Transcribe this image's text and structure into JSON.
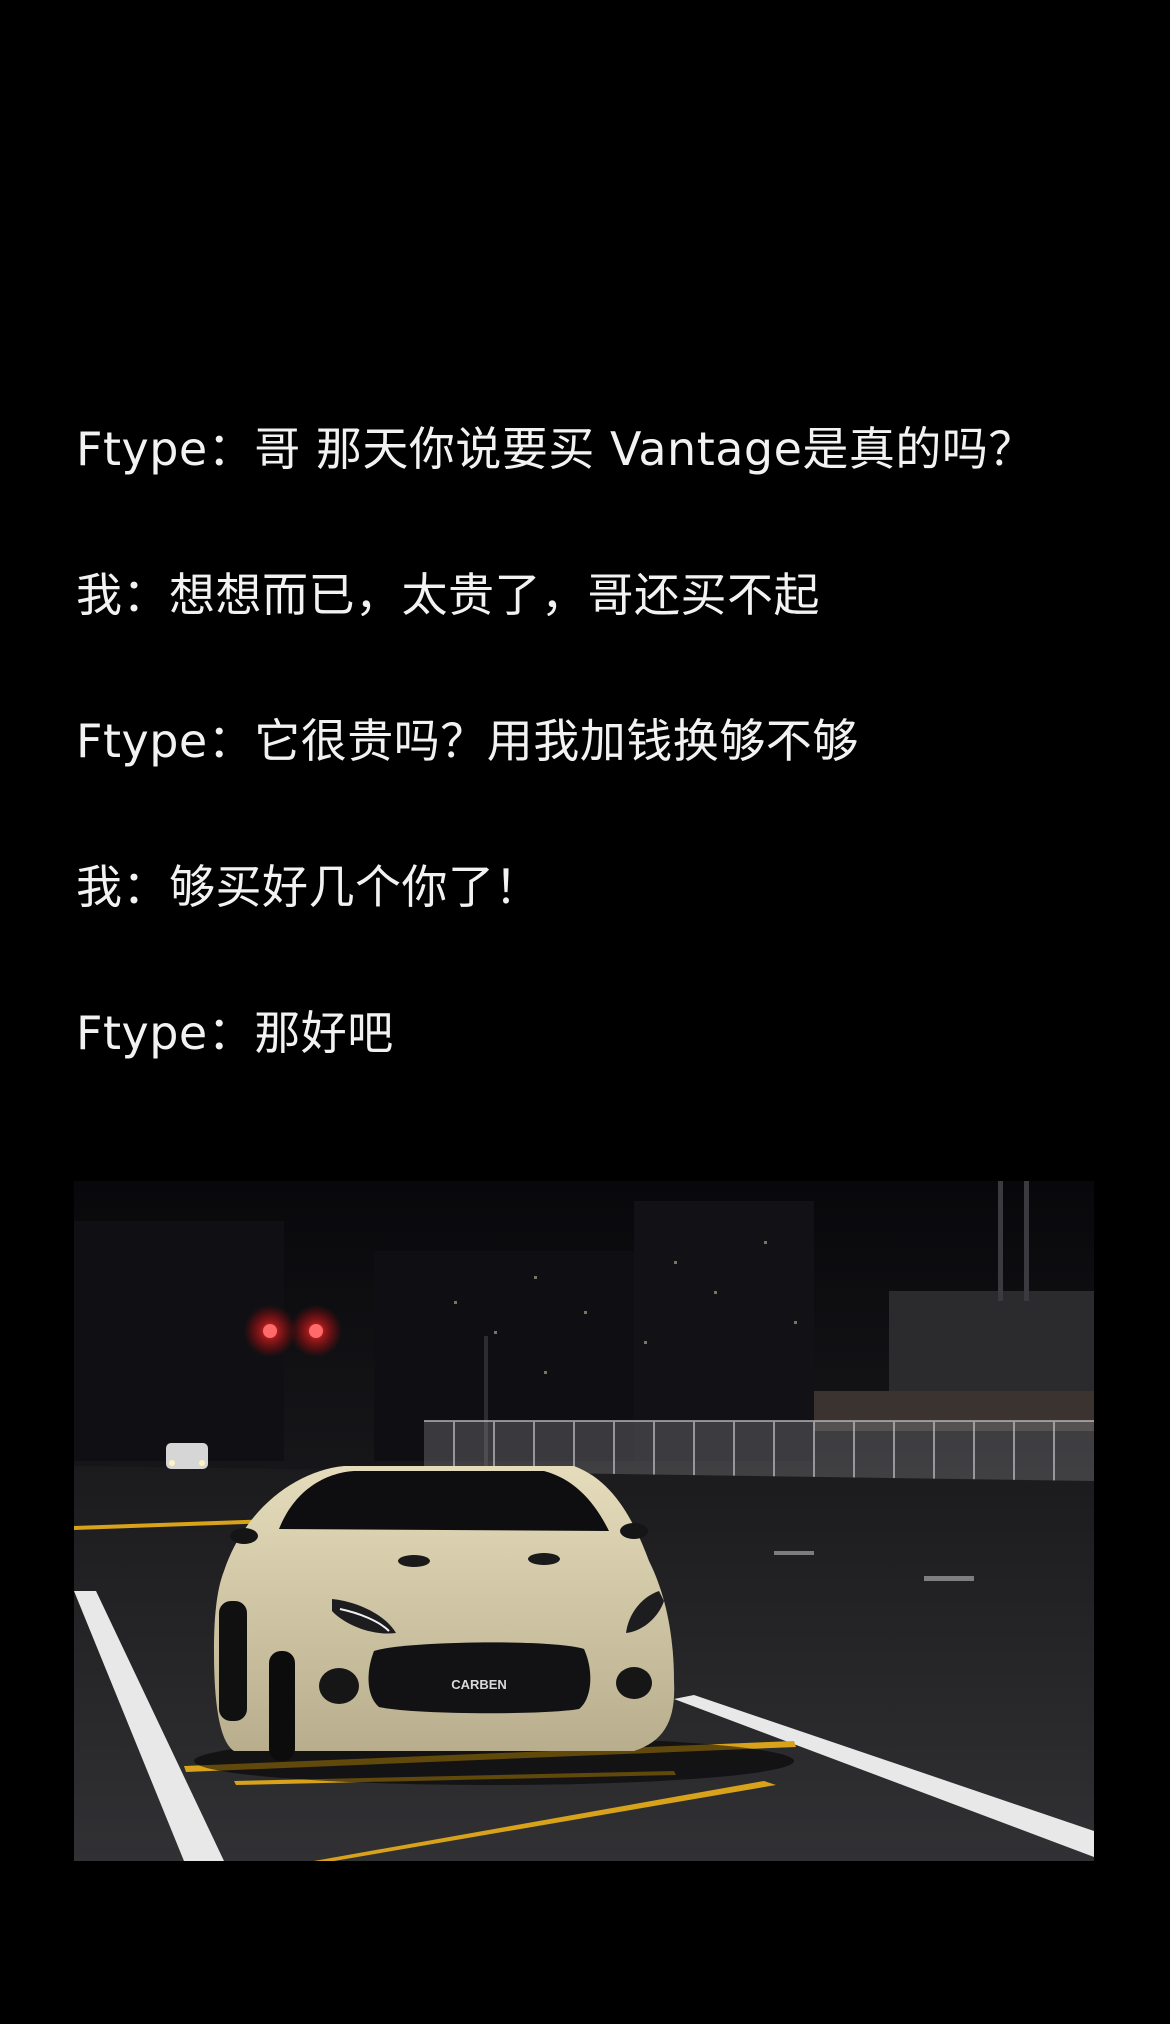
{
  "conversation": [
    {
      "speaker": "Ftype",
      "text": "Ftype：哥 那天你说要买 Vantage是真的吗？"
    },
    {
      "speaker": "我",
      "text": "我：想想而已，太贵了，哥还买不起"
    },
    {
      "speaker": "Ftype",
      "text": "Ftype：它很贵吗？用我加钱换够不够"
    },
    {
      "speaker": "我",
      "text": "我：够买好几个你了！"
    },
    {
      "speaker": "Ftype",
      "text": "Ftype：那好吧"
    }
  ],
  "photo": {
    "plate_text": "CARBEN",
    "colors": {
      "sky": "#0c0c10",
      "road": "#2a2a2d",
      "car_body": "#d9cfae",
      "lane_yellow": "#d8a21a",
      "lane_white": "#e8e8e8",
      "traffic_light": "#ff2a2a"
    }
  }
}
